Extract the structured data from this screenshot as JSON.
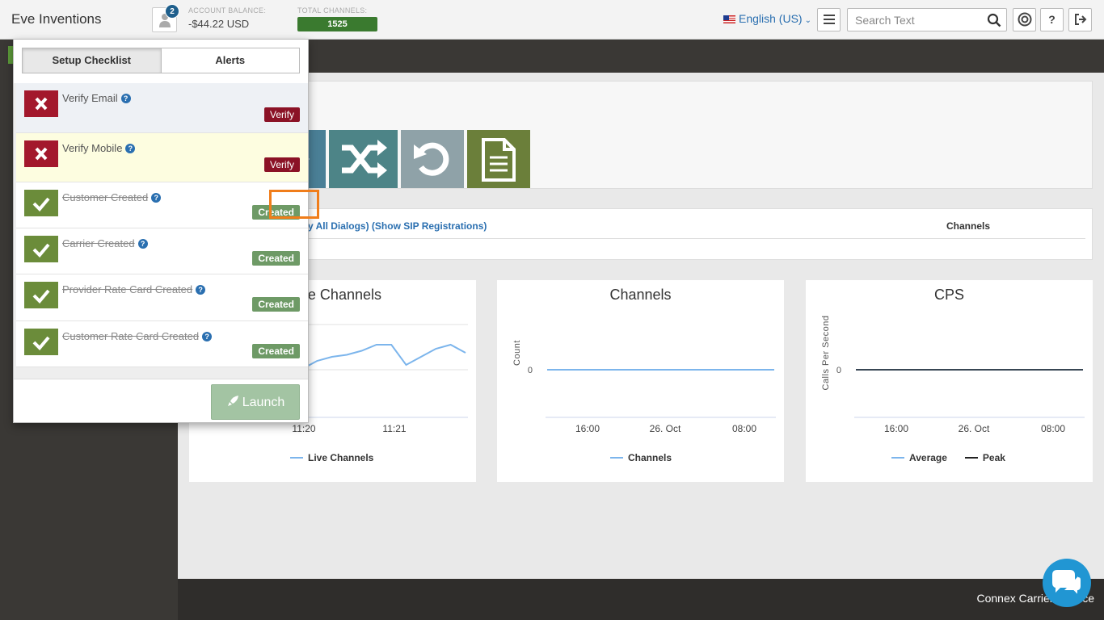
{
  "header": {
    "brand": "Eve Inventions",
    "notification_count": "2",
    "balance_label": "ACCOUNT BALANCE:",
    "balance_value": "-$44.22 USD",
    "channels_label": "TOTAL CHANNELS:",
    "channels_value": "1525",
    "language": "English (US)",
    "search_placeholder": "Search Text",
    "icons": [
      "menu-icon",
      "search-icon",
      "support-icon",
      "help-icon",
      "logout-icon"
    ]
  },
  "dropdown": {
    "tabs": [
      {
        "label": "Setup Checklist",
        "active": true
      },
      {
        "label": "Alerts",
        "active": false
      }
    ],
    "items": [
      {
        "label": "Verify Email",
        "status": "pending",
        "button": "Verify"
      },
      {
        "label": "Verify Mobile",
        "status": "pending",
        "button": "Verify"
      },
      {
        "label": "Customer Created",
        "status": "done",
        "button": "Created"
      },
      {
        "label": "Carrier Created",
        "status": "done",
        "button": "Created"
      },
      {
        "label": "Provider Rate Card Created",
        "status": "done",
        "button": "Created"
      },
      {
        "label": "Customer Rate Card Created",
        "status": "done",
        "button": "Created"
      }
    ],
    "launch_label": "Launch"
  },
  "main": {
    "dialog_links": "lay All Dialogs) (Show SIP Registrations)",
    "channels_col": "Channels"
  },
  "chart_data": [
    {
      "type": "line",
      "title": "e Channels",
      "x": [
        "11:20",
        "11:21"
      ],
      "series": [
        {
          "name": "Live Channels",
          "color": "#7cb5ec",
          "values": [
            1460,
            1480,
            1490,
            1495,
            1505,
            1520,
            1520,
            1470,
            1490,
            1510,
            1520,
            1500
          ]
        }
      ],
      "legend": "bottom"
    },
    {
      "type": "line",
      "title": "Channels",
      "ylabel": "Count",
      "x": [
        "16:00",
        "26. Oct",
        "08:00"
      ],
      "yticks": [
        "0"
      ],
      "series": [
        {
          "name": "Channels",
          "color": "#7cb5ec",
          "values": [
            0,
            0
          ]
        }
      ],
      "legend": "bottom"
    },
    {
      "type": "line",
      "title": "CPS",
      "ylabel": "Calls Per Second",
      "x": [
        "16:00",
        "26. Oct",
        "08:00"
      ],
      "yticks": [
        "0"
      ],
      "series": [
        {
          "name": "Average",
          "color": "#7cb5ec",
          "values": [
            0,
            0
          ]
        },
        {
          "name": "Peak",
          "color": "#222222",
          "values": [
            0,
            0
          ]
        }
      ],
      "legend": "bottom"
    }
  ],
  "footer": {
    "text": "Connex Carrier Service"
  }
}
